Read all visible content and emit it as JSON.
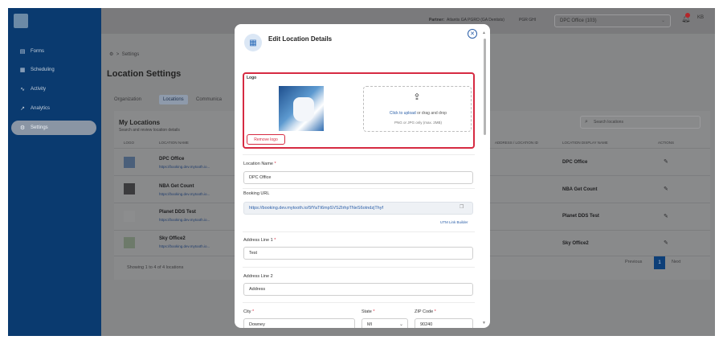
{
  "sidebar": {
    "items": [
      {
        "label": "Forms",
        "icon": "forms-icon",
        "glyph": "▤"
      },
      {
        "label": "Scheduling",
        "icon": "calendar-icon",
        "glyph": "▦"
      },
      {
        "label": "Activity",
        "icon": "activity-icon",
        "glyph": "∿"
      },
      {
        "label": "Analytics",
        "icon": "analytics-icon",
        "glyph": "↗"
      },
      {
        "label": "Settings",
        "icon": "gear-icon",
        "glyph": "⚙",
        "active": true
      }
    ]
  },
  "topbar": {
    "partner_label": "Partner:",
    "partner_name": "Atlantis GA PGRO (GA Dentists)",
    "partner_extra": "PGR GHI",
    "office": "DPC Office (103)",
    "avatar": "KB",
    "notifications": "1"
  },
  "breadcrumb": {
    "home_icon": "⚙",
    "sep": ">",
    "current": "Settings"
  },
  "page_title": "Location Settings",
  "tabs": [
    "Organization",
    "Locations",
    "Communica"
  ],
  "locations": {
    "title": "My Locations",
    "subtitle": "Search and review location details",
    "search_placeholder": "Search locations",
    "columns": {
      "logo": "LOGO",
      "name": "LOCATION NAME",
      "mid": "ADDRESS / LOCATION ID",
      "display": "LOCATION DISPLAY NAME",
      "actions": "ACTIONS"
    },
    "rows": [
      {
        "name": "DPC Office",
        "url": "https://booking.dev.mytooth.io...",
        "display": "DPC Office"
      },
      {
        "name": "NBA Get Count",
        "url": "https://booking.dev.mytooth.io...",
        "display": "NBA Get Count"
      },
      {
        "name": "Planet DDS Test",
        "url": "https://booking.dev.mytooth.io...",
        "display": "Planet DDS Test"
      },
      {
        "name": "Sky Office2",
        "url": "https://booking.dev.mytooth.io...",
        "display": "Sky Office2"
      }
    ],
    "showing": "Showing 1 to 4 of 4 locations",
    "pagination": {
      "prev": "Previous",
      "current": "1",
      "next": "Next"
    }
  },
  "modal": {
    "title": "Edit Location Details",
    "logo_label": "Logo",
    "remove_logo": "Remove logo",
    "upload_link": "Click to upload",
    "upload_rest": "or drag and drop",
    "upload_hint": "PNG or JPG only (max. 2MB)",
    "location_name_label": "Location Name",
    "location_name_value": "DPC Office",
    "booking_url_label": "Booking URL",
    "booking_url_value": "https://booking.dev.mytooth.io/5fYaTt6mpSVSZtrhpTNeS6otndzjThyf",
    "utm_link": "UTM Link Builder",
    "address1_label": "Address Line 1",
    "address1_value": "Test",
    "address2_label": "Address Line 2",
    "address2_placeholder": "Address",
    "city_label": "City",
    "city_value": "Downey",
    "state_label": "State",
    "state_value": "MI",
    "zip_label": "ZIP Code",
    "zip_value": "90240",
    "required_mark": "*"
  },
  "colors": {
    "sidebar": "#0a3a6f",
    "accent": "#2a5ea8",
    "danger": "#d62b42"
  }
}
